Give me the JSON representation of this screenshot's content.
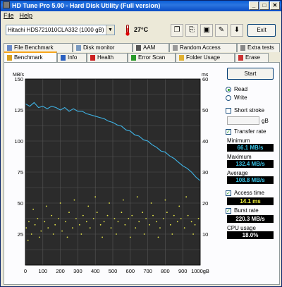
{
  "window": {
    "title": "HD Tune Pro 5.00 - Hard Disk Utility (Full version)",
    "min": "_",
    "max": "□",
    "close": "✕"
  },
  "menu": [
    "File",
    "Help"
  ],
  "toolbar": {
    "drive": "Hitachi HDS721010CLA332 (1000 gB)",
    "temperature": "27°C",
    "exit_label": "Exit"
  },
  "tabs_top": [
    {
      "label": "File Benchmark",
      "icon": "file-benchmark-icon"
    },
    {
      "label": "Disk monitor",
      "icon": "disk-monitor-icon"
    },
    {
      "label": "AAM",
      "icon": "aam-icon"
    },
    {
      "label": "Random Access",
      "icon": "random-access-icon"
    },
    {
      "label": "Extra tests",
      "icon": "extra-tests-icon"
    }
  ],
  "tabs_bottom": [
    {
      "label": "Benchmark",
      "icon": "benchmark-icon",
      "active": true
    },
    {
      "label": "Info",
      "icon": "info-icon"
    },
    {
      "label": "Health",
      "icon": "health-icon"
    },
    {
      "label": "Error Scan",
      "icon": "error-scan-icon"
    },
    {
      "label": "Folder Usage",
      "icon": "folder-usage-icon"
    },
    {
      "label": "Erase",
      "icon": "erase-icon"
    }
  ],
  "controls": {
    "start_label": "Start",
    "read_label": "Read",
    "read_selected": true,
    "write_label": "Write",
    "write_selected": false,
    "short_stroke_label": "Short stroke",
    "short_stroke_checked": false,
    "stroke_unit": "gB",
    "transfer_rate_label": "Transfer rate",
    "transfer_rate_checked": true,
    "access_time_label": "Access time",
    "access_time_checked": true,
    "burst_rate_label": "Burst rate",
    "burst_rate_checked": true
  },
  "results": {
    "minimum_label": "Minimum",
    "minimum": "66.1 MB/s",
    "maximum_label": "Maximum",
    "maximum": "132.4 MB/s",
    "average_label": "Average",
    "average": "108.8 MB/s",
    "access_time": "14.1 ms",
    "burst_rate": "220.3 MB/s",
    "cpu_usage_label": "CPU usage",
    "cpu_usage": "18.0%"
  },
  "chart_data": {
    "type": "line",
    "y_left_label": "MB/s",
    "y_right_label": "ms",
    "y_left_ticks": [
      150,
      125,
      100,
      75,
      50,
      25
    ],
    "y_right_ticks": [
      60,
      50,
      40,
      30,
      20,
      10
    ],
    "x_ticks": [
      "0",
      "100",
      "200",
      "300",
      "400",
      "500",
      "600",
      "700",
      "800",
      "900",
      "1000gB"
    ],
    "xlim": [
      0,
      1000
    ],
    "ylim_left": [
      0,
      150
    ],
    "ylim_right": [
      0,
      60
    ],
    "grid": true,
    "series": [
      {
        "type": "line",
        "color": "#3fb4e6",
        "x": [
          0,
          25,
          50,
          75,
          100,
          125,
          150,
          175,
          200,
          225,
          250,
          275,
          300,
          325,
          350,
          375,
          400,
          425,
          450,
          475,
          500,
          525,
          550,
          575,
          600,
          625,
          650,
          675,
          700,
          725,
          750,
          775,
          800,
          825,
          850,
          875,
          900,
          925,
          950,
          975,
          1000
        ],
        "values": [
          130,
          128,
          131,
          127,
          128,
          126,
          128,
          127,
          125,
          127,
          124,
          126,
          124,
          124,
          122,
          121,
          120,
          119,
          118,
          116,
          115,
          113,
          112,
          109,
          108,
          105,
          104,
          101,
          100,
          97,
          95,
          92,
          91,
          88,
          86,
          83,
          80,
          78,
          75,
          71,
          68
        ]
      },
      {
        "type": "scatter",
        "color": "#e8e84a",
        "x": [
          5,
          20,
          35,
          55,
          70,
          90,
          110,
          130,
          150,
          170,
          190,
          210,
          230,
          250,
          270,
          290,
          310,
          330,
          350,
          370,
          390,
          410,
          430,
          450,
          470,
          490,
          510,
          530,
          550,
          570,
          590,
          610,
          630,
          650,
          670,
          690,
          710,
          730,
          750,
          770,
          790,
          810,
          830,
          850,
          870,
          890,
          910,
          930,
          950,
          970,
          990,
          15,
          45,
          80,
          120,
          160,
          200,
          240,
          280,
          320,
          360,
          400,
          440,
          480,
          520,
          560,
          600,
          640,
          680,
          720,
          760,
          800,
          840,
          880,
          920,
          960
        ],
        "values": [
          12,
          14,
          10,
          13,
          15,
          11,
          14,
          12,
          16,
          13,
          15,
          11,
          14,
          17,
          12,
          15,
          13,
          16,
          14,
          12,
          15,
          17,
          13,
          14,
          16,
          12,
          15,
          14,
          17,
          13,
          15,
          16,
          12,
          14,
          17,
          15,
          13,
          16,
          14,
          12,
          15,
          17,
          13,
          16,
          14,
          15,
          12,
          16,
          14,
          13,
          15,
          8,
          18,
          9,
          19,
          10,
          20,
          9,
          21,
          10,
          19,
          22,
          9,
          20,
          10,
          21,
          9,
          22,
          10,
          20,
          9,
          21,
          10,
          19,
          22,
          10
        ]
      }
    ]
  }
}
